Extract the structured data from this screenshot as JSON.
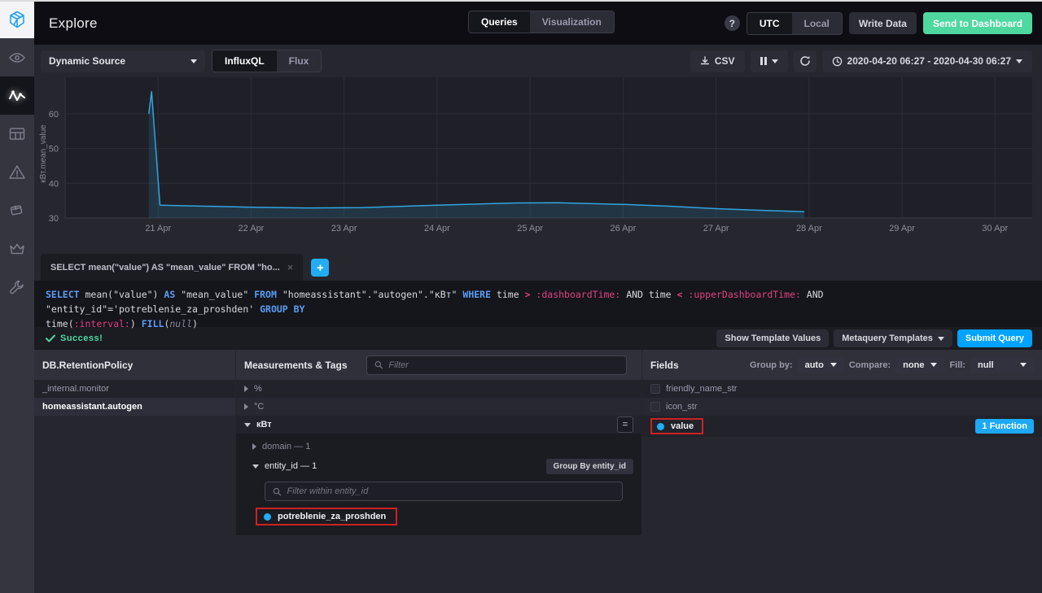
{
  "sidebar": {
    "items": [
      {
        "icon": "chronograf-logo",
        "active": false,
        "logo": true
      },
      {
        "icon": "eye",
        "active": false
      },
      {
        "icon": "pulse-graph",
        "active": true
      },
      {
        "icon": "dashboards",
        "active": false
      },
      {
        "icon": "alert-triangle",
        "active": false
      },
      {
        "icon": "integrations-cube",
        "active": false
      },
      {
        "icon": "crown-admin",
        "active": false
      },
      {
        "icon": "wrench-config",
        "active": false
      }
    ]
  },
  "topnav": {
    "title": "Explore",
    "view_tabs": [
      {
        "label": "Queries",
        "active": true
      },
      {
        "label": "Visualization",
        "active": false
      }
    ],
    "help_label": "?",
    "timezone_tabs": [
      {
        "label": "UTC",
        "active": true
      },
      {
        "label": "Local",
        "active": false
      }
    ],
    "write_data_label": "Write Data",
    "send_to_dashboard_label": "Send to Dashboard"
  },
  "toolbar": {
    "source_dropdown_value": "Dynamic Source",
    "language_tabs": [
      {
        "label": "InfluxQL",
        "active": true
      },
      {
        "label": "Flux",
        "active": false
      }
    ],
    "csv_label": "CSV",
    "time_range_value": "2020-04-20 06:27 - 2020-04-30 06:27"
  },
  "chart_data": {
    "type": "area",
    "title": "",
    "xlabel": "",
    "ylabel": "кВт.mean_value",
    "ylim": [
      30,
      67
    ],
    "y_ticks": [
      30,
      40,
      50,
      60
    ],
    "x_tick_days": [
      21,
      22,
      23,
      24,
      25,
      26,
      27,
      28,
      29,
      30
    ],
    "x_ticks": [
      "21 Apr",
      "22 Apr",
      "23 Apr",
      "24 Apr",
      "25 Apr",
      "26 Apr",
      "27 Apr",
      "28 Apr",
      "29 Apr",
      "30 Apr"
    ],
    "xlim_days": [
      20,
      30.4
    ],
    "grid": true,
    "legend": "none",
    "series": [
      {
        "name": "кВт.mean_value",
        "color": "#31a5e0",
        "fill": "rgba(49,165,224,0.16)",
        "points": [
          [
            20.9,
            60.0
          ],
          [
            20.93,
            66.4
          ],
          [
            21.02,
            33.7
          ],
          [
            21.5,
            33.4
          ],
          [
            22.0,
            33.1
          ],
          [
            22.6,
            32.9
          ],
          [
            23.2,
            33.0
          ],
          [
            24.0,
            33.7
          ],
          [
            24.8,
            34.3
          ],
          [
            25.3,
            34.4
          ],
          [
            26.0,
            33.9
          ],
          [
            26.5,
            33.4
          ],
          [
            27.0,
            32.7
          ],
          [
            27.5,
            32.2
          ],
          [
            27.95,
            31.8
          ]
        ]
      }
    ]
  },
  "query_editor": {
    "tab_label": "SELECT mean(\"value\") AS \"mean_value\" FROM \"ho...",
    "tab_close": "×",
    "add_tab_label": "+",
    "query_lines": [
      [
        {
          "t": "SELECT",
          "c": "kw"
        },
        {
          "t": " mean(\"value\") ",
          "c": "pl"
        },
        {
          "t": "AS",
          "c": "kw"
        },
        {
          "t": " \"mean_value\" ",
          "c": "pl"
        },
        {
          "t": "FROM",
          "c": "kw"
        },
        {
          "t": " \"homeassistant\".\"autogen\".\"кВт\" ",
          "c": "pl"
        },
        {
          "t": "WHERE",
          "c": "kw"
        },
        {
          "t": " time ",
          "c": "pl"
        },
        {
          "t": "> ",
          "c": "op"
        },
        {
          "t": ":dashboardTime:",
          "c": "tv"
        },
        {
          "t": " AND time ",
          "c": "pl"
        },
        {
          "t": "< ",
          "c": "op"
        },
        {
          "t": ":upperDashboardTime:",
          "c": "tv"
        },
        {
          "t": " AND \"entity_id\"='potreblenie_za_proshden' ",
          "c": "pl"
        },
        {
          "t": "GROUP BY",
          "c": "kw"
        }
      ],
      [
        {
          "t": "time(",
          "c": "pl"
        },
        {
          "t": ":interval:",
          "c": "tv"
        },
        {
          "t": ") ",
          "c": "pl"
        },
        {
          "t": "FILL",
          "c": "kw"
        },
        {
          "t": "(",
          "c": "pl"
        },
        {
          "t": "null",
          "c": "nul"
        },
        {
          "t": ")",
          "c": "pl"
        }
      ]
    ]
  },
  "status": {
    "success_label": "Success!",
    "show_template_values_label": "Show Template Values",
    "metaquery_templates_label": "Metaquery Templates",
    "submit_query_label": "Submit Query"
  },
  "builder": {
    "db_panel": {
      "header": "DB.RetentionPolicy",
      "items": [
        {
          "label": "_internal.monitor",
          "selected": false
        },
        {
          "label": "homeassistant.autogen",
          "selected": true
        }
      ]
    },
    "measurements_panel": {
      "header": "Measurements & Tags",
      "filter_placeholder": "Filter",
      "items": [
        {
          "label": "%"
        },
        {
          "label": "°C"
        }
      ],
      "expanded_measurement": {
        "label": "кВт",
        "badge": "=",
        "tags": [
          {
            "label": "domain — 1",
            "expanded": false
          },
          {
            "label": "entity_id — 1",
            "expanded": true,
            "group_by_label": "Group By entity_id"
          }
        ],
        "tag_filter_placeholder": "Filter within entity_id",
        "tag_values": [
          {
            "label": "potreblenie_za_proshden",
            "selected": true,
            "annotated": true
          }
        ]
      }
    },
    "fields_panel": {
      "header": "Fields",
      "group_by_label": "Group by:",
      "group_by_value": "auto",
      "compare_label": "Compare:",
      "compare_value": "none",
      "fill_label": "Fill:",
      "fill_value": "null",
      "items": [
        {
          "label": "friendly_name_str",
          "selected": false
        },
        {
          "label": "icon_str",
          "selected": false
        },
        {
          "label": "value",
          "selected": true,
          "annotated": true,
          "function_badge": "1 Function"
        }
      ]
    }
  },
  "colors": {
    "accent_blue": "#22adf6",
    "submit_blue": "#00a3ff",
    "success_green": "#4ed8a0",
    "annotation_red": "#cc2222",
    "line_blue": "#31a5e0"
  }
}
